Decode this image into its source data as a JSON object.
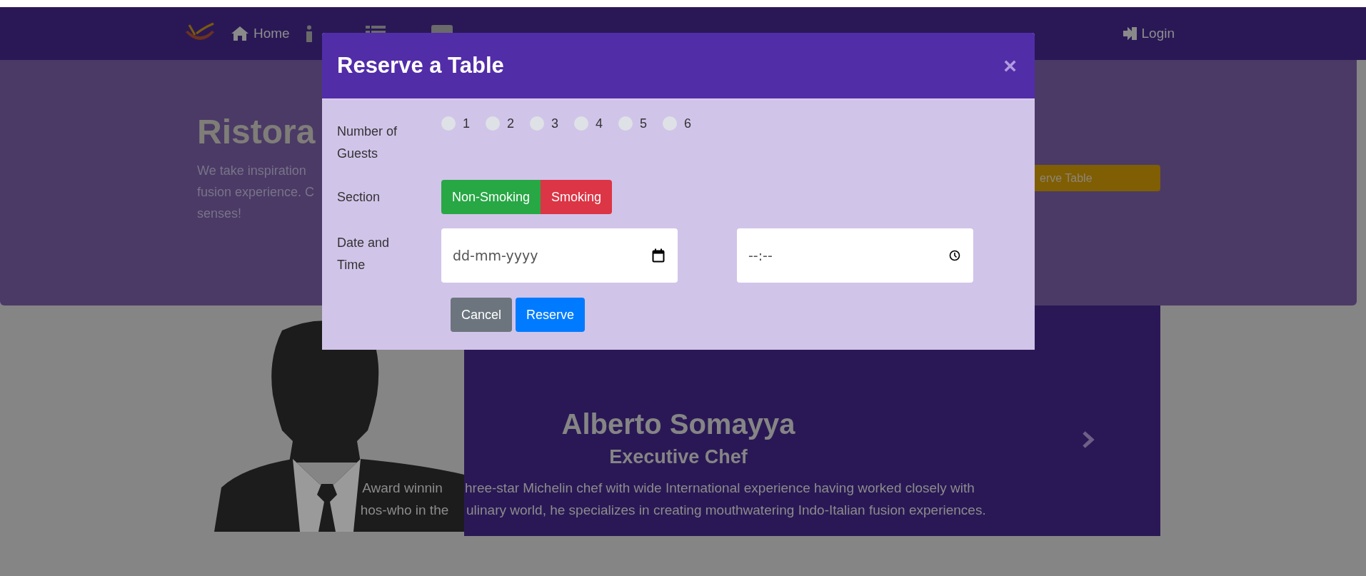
{
  "navbar": {
    "home": "Home",
    "login": "Login"
  },
  "jumbotron": {
    "title": "Ristora",
    "lines": [
      "We take inspiration",
      "fusion experience. C",
      "senses!"
    ],
    "button": "erve Table"
  },
  "chef": {
    "name": "Alberto Somayya",
    "role": "Executive Chef",
    "lines": [
      [
        "Award winnin",
        "hree-star Michelin chef with wide International experience having worked closely with"
      ],
      [
        "hos-who in the",
        "ulinary world, he specializes in creating mouthwatering Indo-Italian fusion experiences."
      ]
    ]
  },
  "modal": {
    "title": "Reserve a Table",
    "close": "×",
    "guests": {
      "label": "Number of Guests",
      "options": [
        {
          "label": "1",
          "selected": false
        },
        {
          "label": "2",
          "selected": false
        },
        {
          "label": "3",
          "selected": false
        },
        {
          "label": "4",
          "selected": false
        },
        {
          "label": "5",
          "selected": false
        },
        {
          "label": "6",
          "selected": false
        }
      ]
    },
    "section": {
      "label": "Section",
      "options": [
        {
          "label": "Non-Smoking",
          "kind": "success"
        },
        {
          "label": "Smoking",
          "kind": "danger"
        }
      ]
    },
    "datetime": {
      "label": "Date and Time",
      "date_placeholder": "dd-mm-yyyy",
      "time_placeholder": "--:--"
    },
    "buttons": [
      {
        "label": "Cancel",
        "kind": "secondary"
      },
      {
        "label": "Reserve",
        "kind": "primary"
      }
    ]
  }
}
